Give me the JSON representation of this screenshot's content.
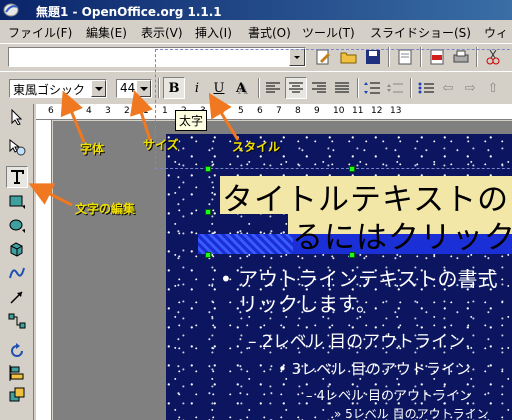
{
  "window": {
    "title": "無題1 - OpenOffice.org 1.1.1"
  },
  "menu": {
    "items": [
      "ファイル(F)",
      "編集(E)",
      "表示(V)",
      "挿入(I)",
      "書式(O)",
      "ツール(T)",
      "スライドショー(S)",
      "ウィ"
    ]
  },
  "function_bar": {
    "url_value": ""
  },
  "object_bar": {
    "font_name": "東風ゴシック",
    "font_size": "44",
    "bold": "B",
    "italic": "i",
    "underline": "U",
    "shadow": "A"
  },
  "tooltip": {
    "text": "太字"
  },
  "ruler": {
    "labels": [
      "6",
      "5",
      "4",
      "3",
      "2",
      "1",
      "1",
      "2",
      "3",
      "4",
      "5",
      "6",
      "7",
      "8",
      "9",
      "10",
      "11",
      "12",
      "13"
    ]
  },
  "slide": {
    "title_line1": "タイトルテキストの",
    "title_line2": "るにはクリック",
    "outline": [
      "• アウトラインテキストの書式",
      "リックします。",
      "– 2レベル 目のアウトライン",
      "• 3レベル 目のアウトライン",
      "– 4レベル 目のアウトライン",
      "» 5レベル 目のアウトライン"
    ]
  },
  "annotations": {
    "font": "字体",
    "size": "サイズ",
    "style": "スタイル",
    "text_edit": "文字の編集"
  },
  "colors": {
    "annotation": "#f0e000",
    "arrow": "#f07820",
    "slide_bg": "#0b1560",
    "selection_handle": "#1aff1a"
  }
}
